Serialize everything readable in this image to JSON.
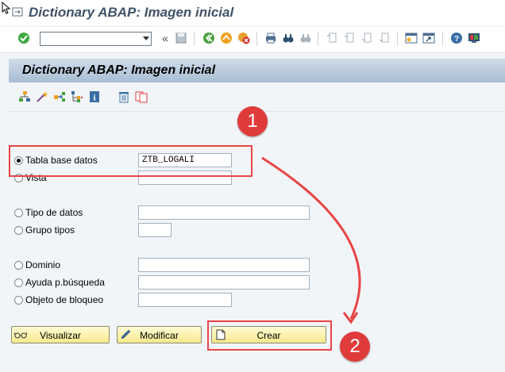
{
  "window": {
    "title": "Dictionary ABAP: Imagen inicial"
  },
  "toolbar": {
    "command_value": "",
    "icons": [
      "check-icon",
      "back-double-icon",
      "save-icon",
      "back-icon",
      "exit-icon",
      "cancel-icon",
      "print-icon",
      "find-icon",
      "find-next-icon",
      "first-page-icon",
      "prev-page-icon",
      "next-page-icon",
      "last-page-icon",
      "new-session-icon",
      "shortcut-icon",
      "help-icon",
      "customize-icon"
    ]
  },
  "screen": {
    "title": "Dictionary ABAP: Imagen inicial"
  },
  "options": [
    {
      "label": "Tabla base datos",
      "value": "ZTB_LOGALI",
      "selected": true
    },
    {
      "label": "Vista",
      "value": "",
      "selected": false
    },
    {
      "label": "Tipo de datos",
      "value": "",
      "selected": false
    },
    {
      "label": "Grupo tipos",
      "value": "",
      "selected": false
    },
    {
      "label": "Dominio",
      "value": "",
      "selected": false
    },
    {
      "label": "Ayuda p.búsqueda",
      "value": "",
      "selected": false
    },
    {
      "label": "Objeto de bloqueo",
      "value": "",
      "selected": false
    }
  ],
  "buttons": {
    "display": "Visualizar",
    "modify": "Modificar",
    "create": "Crear"
  },
  "annotations": {
    "step1": "1",
    "step2": "2"
  },
  "colors": {
    "highlight": "#e84545",
    "badge": "#e03b3b",
    "button_bg": "#f7e98c",
    "header": "#a9bdd3"
  }
}
